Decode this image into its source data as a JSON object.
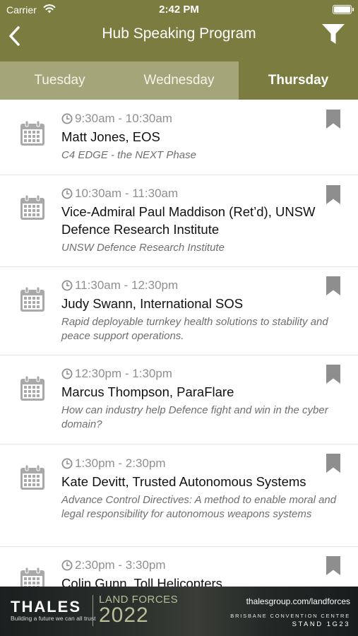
{
  "status_bar": {
    "carrier": "Carrier",
    "time": "2:42 PM"
  },
  "nav": {
    "title": "Hub Speaking Program",
    "back_icon": "chevron-left-icon",
    "filter_icon": "filter-icon"
  },
  "tabs": [
    {
      "label": "Tuesday",
      "selected": false
    },
    {
      "label": "Wednesday",
      "selected": false
    },
    {
      "label": "Thursday",
      "selected": true
    }
  ],
  "sessions": [
    {
      "time": "9:30am - 10:30am",
      "speaker": "Matt Jones, EOS",
      "topic": "C4 EDGE - the NEXT Phase"
    },
    {
      "time": "10:30am - 11:30am",
      "speaker": "Vice-Admiral Paul Maddison (Ret’d), UNSW Defence Research Institute",
      "topic": "UNSW Defence Research Institute"
    },
    {
      "time": "11:30am - 12:30pm",
      "speaker": "Judy Swann, International SOS",
      "topic": "Rapid deployable turnkey health solutions to stability and peace support operations."
    },
    {
      "time": "12:30pm - 1:30pm",
      "speaker": "Marcus Thompson, ParaFlare",
      "topic": "How can industry help Defence fight and win in the cyber domain?"
    },
    {
      "time": "1:30pm - 2:30pm",
      "speaker": "Kate Devitt, Trusted Autonomous Systems",
      "topic": "Advance Control Directives: A method to enable moral and legal responsibility for autonomous weapons systems"
    },
    {
      "time": "2:30pm - 3:30pm",
      "speaker": "Colin Gunn, Toll Helicopters",
      "topic": ""
    }
  ],
  "banner": {
    "brand": "THALES",
    "tagline": "Building a future we can all trust",
    "event": "LAND FORCES",
    "event_year": "2022",
    "site": "thalesgroup.com/landforces",
    "venue": "BRISBANE CONVENTION CENTRE",
    "stand": "STAND 1G23"
  },
  "colors": {
    "nav_bg": "#7a7d3f",
    "tab_inactive_bg": "#a4a67a",
    "icon_gray": "#a9a9a9"
  }
}
